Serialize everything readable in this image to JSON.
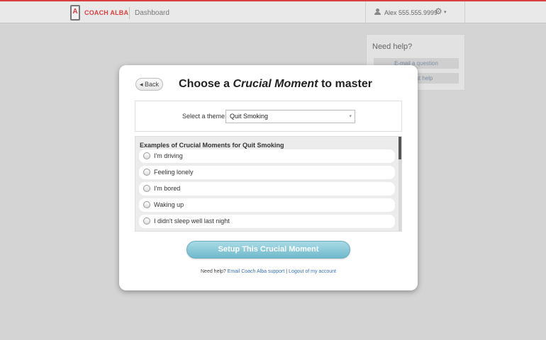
{
  "topbar": {
    "brand": "COACH ALBA",
    "nav_item": "Dashboard",
    "user_label": "Alex 555.555.9999",
    "logo_glyph": "A"
  },
  "help_panel": {
    "title": "Need help?",
    "email_button": "E-mail a question",
    "suggest_button": "Suggest help"
  },
  "modal": {
    "back_label": "◂ Back",
    "title_prefix": "Choose a",
    "title_emphasis": "Crucial Moment",
    "title_suffix": "to master",
    "theme_label": "Select a theme:",
    "theme_selected": "Quit Smoking",
    "examples_title": "Examples of Crucial Moments for Quit Smoking",
    "options": [
      {
        "label": "I'm driving"
      },
      {
        "label": "Feeling lonely"
      },
      {
        "label": "I'm bored"
      },
      {
        "label": "Waking up"
      },
      {
        "label": "I didn't sleep well last night"
      }
    ],
    "setup_button": "Setup This Crucial Moment",
    "footer_prefix": "Need help?",
    "footer_link_email": "Email Coach Alba support",
    "footer_sep": "|",
    "footer_link_logout": "Logout of my account"
  },
  "colors": {
    "brand_red": "#d94040",
    "setup_button": "#8fcbda",
    "link_blue": "#3b6fb3"
  }
}
